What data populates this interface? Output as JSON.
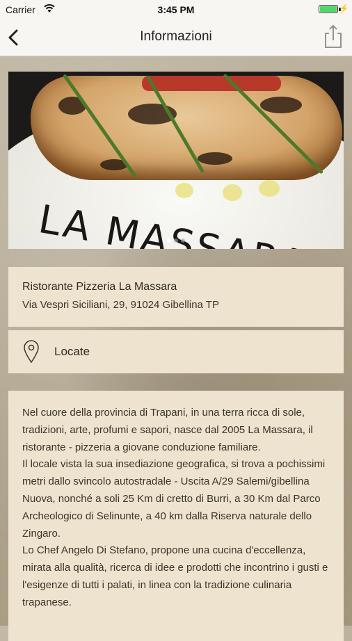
{
  "status_bar": {
    "carrier": "Carrier",
    "time": "3:45 PM",
    "battery_level": 1.0
  },
  "nav": {
    "title": "Informazioni",
    "back_icon": "chevron-left-icon",
    "share_icon": "share-icon"
  },
  "photo": {
    "overlay_text": "LA MASSARA",
    "page_count": 3,
    "active_page": 1
  },
  "restaurant": {
    "name": "Ristorante Pizzeria La Massara",
    "address": "Via Vespri Siciliani, 29, 91024 Gibellina TP"
  },
  "locate": {
    "label": "Locate",
    "icon": "map-pin-icon"
  },
  "description": {
    "paragraphs": [
      "Nel cuore della provincia di Trapani, in una terra ricca di sole, tradizioni, arte, profumi e sapori, nasce dal 2005 La Massara, il ristorante - pizzeria a giovane conduzione familiare.",
      "Il locale vista la sua insediazione geografica, si trova a pochissimi metri dallo svincolo autostradale - Uscita A/29 Salemi/gibellina Nuova, nonché a soli 25 Km di cretto di Burri, a 30 Km dal Parco Archeologico di Selinunte, a 40 km dalla Riserva naturale dello Zingaro.",
      "Lo Chef Angelo Di Stefano, propone una cucina d'eccellenza, mirata alla qualità, ricerca di idee e prodotti che incontrino i gusti e l'esigenze di tutti i palati, in linea con la tradizione culinaria trapanese."
    ]
  }
}
